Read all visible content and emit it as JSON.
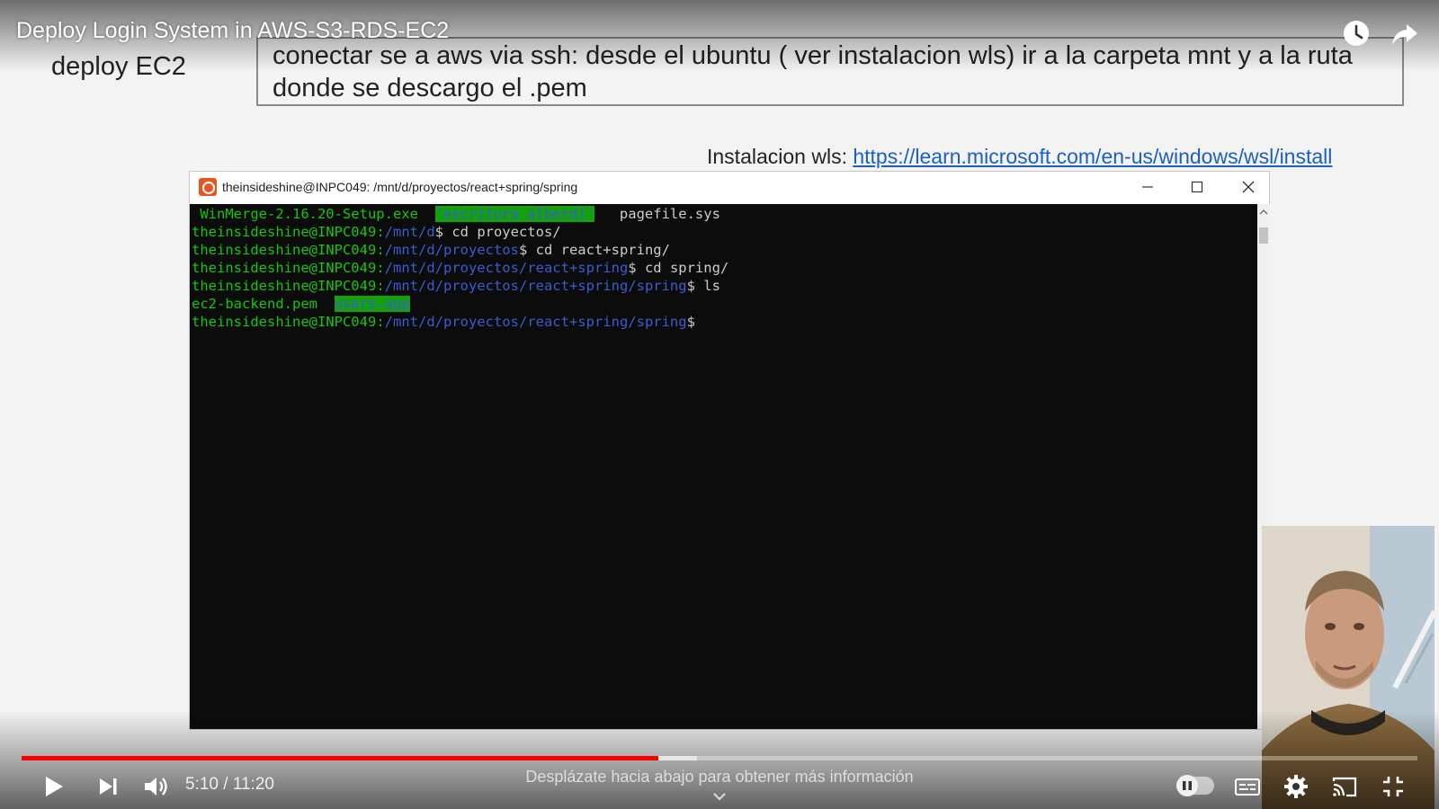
{
  "player": {
    "title": "Deploy Login System in AWS-S3-RDS-EC2",
    "time_current": "5:10",
    "time_total": "11:20",
    "time_display": "5:10 / 11:20",
    "progress_played_fraction": 0.456,
    "progress_buffered_fraction": 0.484,
    "scroll_hint": "Desplázate hacia abajo para obtener más información",
    "autoplay_on": false,
    "accent_color": "#ff0000",
    "icons": [
      "clock-icon",
      "share-icon",
      "play-icon",
      "next-icon",
      "volume-icon",
      "autoplay-icon",
      "subtitles-icon",
      "gear-icon",
      "cast-icon",
      "exit-fullscreen-icon"
    ]
  },
  "slide": {
    "heading": "deploy EC2",
    "note": "conectar se a aws via ssh: desde el ubuntu ( ver instalacion wls) ir a la carpeta mnt y a la ruta donde se descargo el .pem",
    "wsl_label": "Instalacion wls: ",
    "wsl_link": "https://learn.microsoft.com/en-us/windows/wsl/install"
  },
  "terminal": {
    "window_title": "theinsideshine@INPC049: /mnt/d/proyectos/react+spring/spring",
    "line1": {
      "file1": " WinMerge-2.16.20-Setup.exe  ",
      "dir_highlight": "'escritura alberdi'",
      "file2": "   pagefile.sys"
    },
    "prompt_user": "theinsideshine@INPC049",
    "lines": [
      {
        "path": "/mnt/d",
        "cmd": "$ cd proyectos/"
      },
      {
        "path": "/mnt/d/proyectos",
        "cmd": "$ cd react+spring/"
      },
      {
        "path": "/mnt/d/proyectos/react+spring",
        "cmd": "$ cd spring/"
      },
      {
        "path": "/mnt/d/proyectos/react+spring/spring",
        "cmd": "$ ls"
      }
    ],
    "ls_output": {
      "file": "ec2-backend.pem  ",
      "dir_highlight": "users-app"
    },
    "final_prompt": {
      "path": "/mnt/d/proyectos/react+spring/spring",
      "cmd": "$"
    }
  }
}
